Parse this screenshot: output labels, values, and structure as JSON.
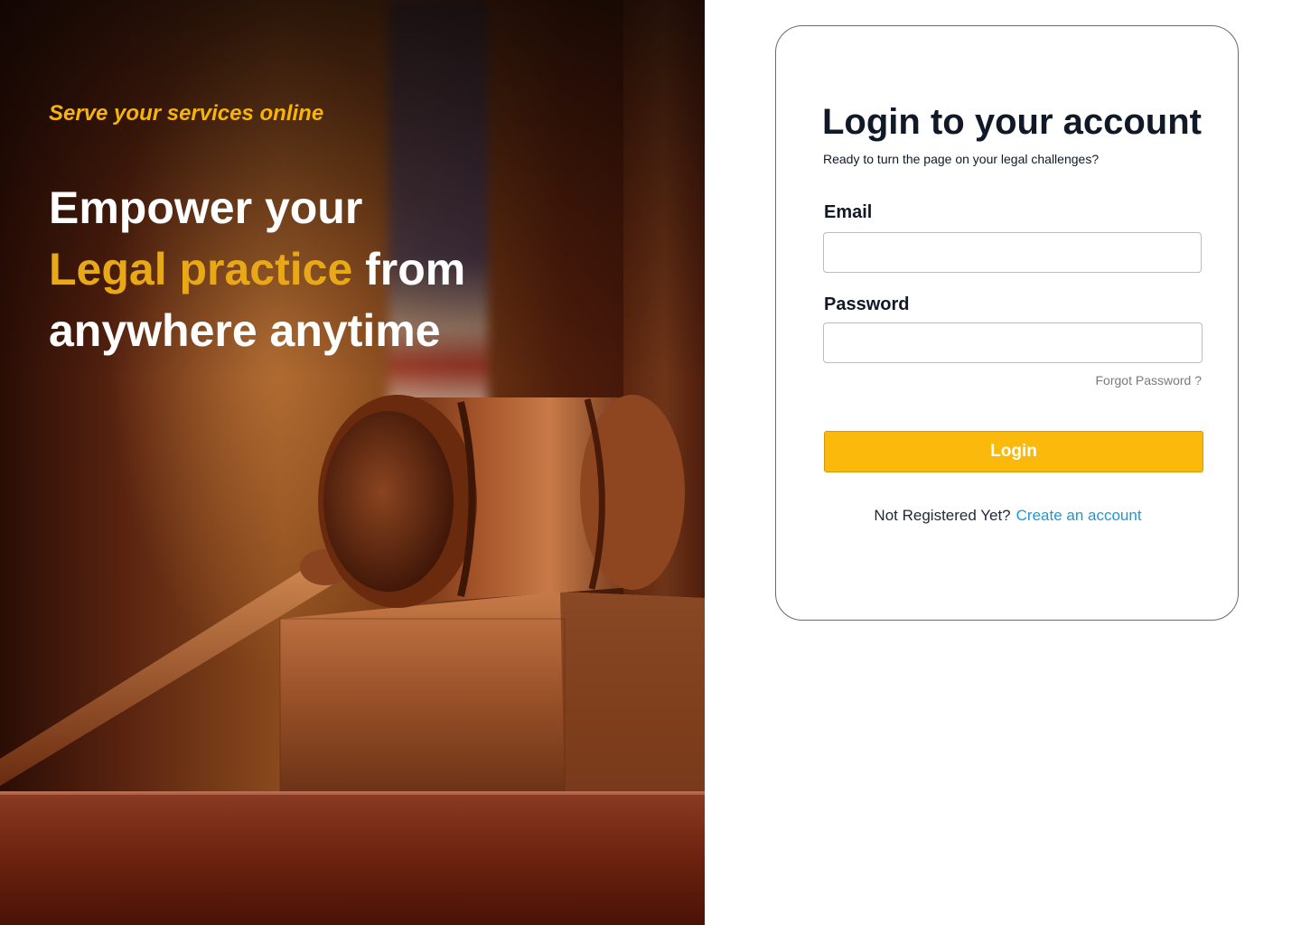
{
  "hero": {
    "tagline": "Serve your services online",
    "headline_line1": "Empower your",
    "headline_accent": "Legal practice",
    "headline_after_accent": " from",
    "headline_line3": "anywhere anytime"
  },
  "login": {
    "title": "Login to your account",
    "subtitle": "Ready to turn the page on your legal challenges?",
    "email_label": "Email",
    "email_value": "",
    "password_label": "Password",
    "password_value": "",
    "forgot_password": "Forgot Password ?",
    "login_button": "Login",
    "not_registered": "Not Registered Yet?",
    "create_account": "Create an account"
  },
  "colors": {
    "accent_yellow": "#fbb90c",
    "headline_accent": "#e8a817",
    "link_blue": "#1a9ad6",
    "text_dark": "#111827"
  }
}
